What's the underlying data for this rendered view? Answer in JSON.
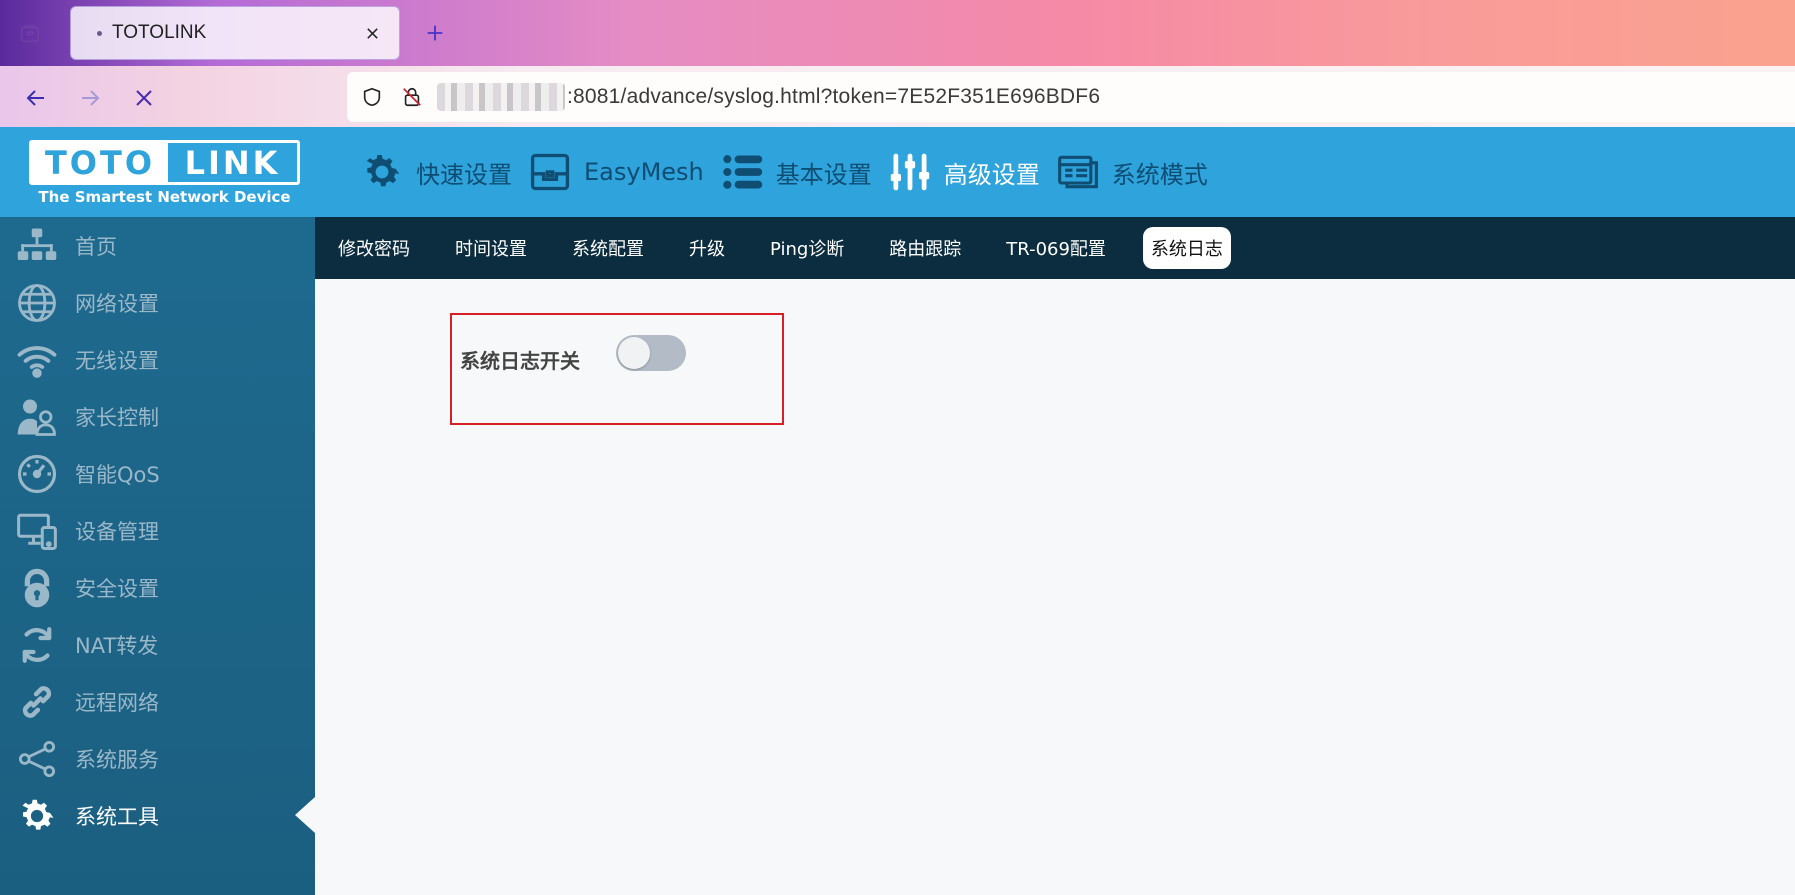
{
  "browser": {
    "tab_title": "TOTOLINK",
    "url_visible": ":8081/advance/syslog.html?token=7E52F351E696BDF6",
    "icons": [
      "tab-overview-icon",
      "tab-close-icon",
      "new-tab-icon",
      "back-icon",
      "forward-icon",
      "stop-icon",
      "shield-icon",
      "insecure-lock-icon"
    ]
  },
  "header": {
    "logo_left": "TOTO",
    "logo_right": "LINK",
    "tagline": "The Smartest Network Device",
    "menu": [
      {
        "label": "快速设置",
        "icon": "gear-icon",
        "active": false
      },
      {
        "label": "EasyMesh",
        "icon": "mesh-icon",
        "active": false
      },
      {
        "label": "基本设置",
        "icon": "list-icon",
        "active": false
      },
      {
        "label": "高级设置",
        "icon": "sliders-icon",
        "active": true
      },
      {
        "label": "系统模式",
        "icon": "mode-icon",
        "active": false
      }
    ]
  },
  "sidebar": {
    "items": [
      {
        "label": "首页",
        "icon": "network-tree-icon"
      },
      {
        "label": "网络设置",
        "icon": "globe-icon"
      },
      {
        "label": "无线设置",
        "icon": "wifi-icon"
      },
      {
        "label": "家长控制",
        "icon": "parent-icon"
      },
      {
        "label": "智能QoS",
        "icon": "gauge-icon"
      },
      {
        "label": "设备管理",
        "icon": "devices-icon"
      },
      {
        "label": "安全设置",
        "icon": "lock-icon"
      },
      {
        "label": "NAT转发",
        "icon": "refresh-icon"
      },
      {
        "label": "远程网络",
        "icon": "link-icon"
      },
      {
        "label": "系统服务",
        "icon": "share-icon"
      },
      {
        "label": "系统工具",
        "icon": "gear-icon",
        "active": true
      }
    ]
  },
  "subnav": {
    "items": [
      "修改密码",
      "时间设置",
      "系统配置",
      "升级",
      "Ping诊断",
      "路由跟踪",
      "TR-069配置",
      "系统日志"
    ],
    "active": "系统日志"
  },
  "content": {
    "syslog_switch_label": "系统日志开关",
    "syslog_switch_on": false
  },
  "colors": {
    "header_bg": "#2ea3dc",
    "sidebar_bg": "#1e6a8f",
    "subnav_bg": "#0b2d3f",
    "highlight_border": "#d81f26",
    "toggle_off": "#b3bcc6"
  }
}
